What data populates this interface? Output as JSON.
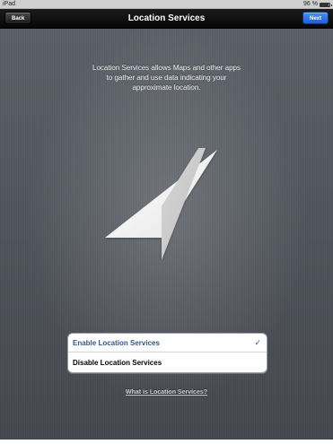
{
  "status_bar": {
    "device": "iPad",
    "battery": "96 %"
  },
  "nav_bar": {
    "title": "Location Services",
    "back_label": "Back",
    "next_label": "Next"
  },
  "intro_text": "Location Services allows Maps and other apps to gather and use data indicating your approximate location.",
  "hero_icon": "location-arrow-icon",
  "options": [
    {
      "label": "Enable Location Services",
      "selected": true
    },
    {
      "label": "Disable Location Services",
      "selected": false
    }
  ],
  "check_mark": "✓",
  "help_link": "What is Location Services?",
  "colors": {
    "selected_text": "#385487",
    "next_button": "#2f6fe8",
    "background": "#53575f"
  }
}
